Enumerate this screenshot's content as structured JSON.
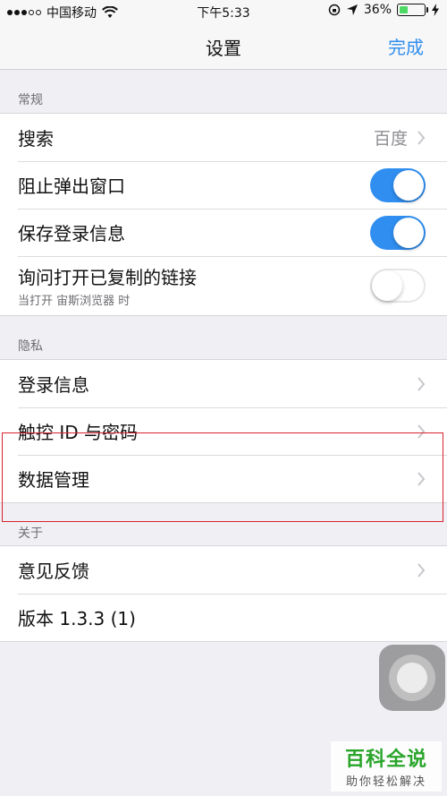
{
  "status_bar": {
    "carrier": "中国移动",
    "time": "下午5:33",
    "battery_percent": "36%",
    "battery_level": 0.36
  },
  "nav": {
    "title": "设置",
    "done_label": "完成"
  },
  "sections": {
    "general": {
      "header": "常规",
      "search_label": "搜索",
      "search_value": "百度",
      "block_popups_label": "阻止弹出窗口",
      "block_popups_on": true,
      "save_login_label": "保存登录信息",
      "save_login_on": true,
      "ask_link_label": "询问打开已复制的链接",
      "ask_link_sub": "当打开 宙斯浏览器 时",
      "ask_link_on": false
    },
    "privacy": {
      "header": "隐私",
      "login_info_label": "登录信息",
      "touch_id_label": "触控 ID 与密码",
      "data_manage_label": "数据管理"
    },
    "about": {
      "header": "关于",
      "feedback_label": "意见反馈",
      "version_label": "版本 1.3.3 (1)"
    }
  },
  "watermark": {
    "main": "百科全说",
    "sub": "助你轻松解决"
  },
  "colors": {
    "accent": "#2f8ef0",
    "background": "#efeff4",
    "highlight": "#d9232e",
    "battery": "#4cd964"
  }
}
